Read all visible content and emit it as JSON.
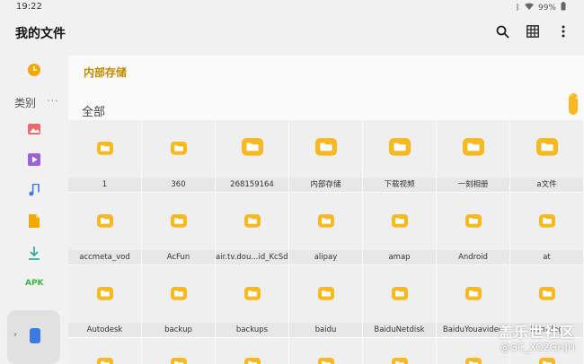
{
  "status": {
    "time": "19:22",
    "battery": "99%"
  },
  "app": {
    "title": "我的文件"
  },
  "sidebar": {
    "category_label": "类别",
    "more": "···",
    "apk_label": "APK"
  },
  "main": {
    "breadcrumb": "内部存储",
    "section": "全部",
    "scroll_hint": "⌃⌄"
  },
  "folders": [
    "1",
    "360",
    "268159164",
    "内部存储",
    "下载视频",
    "一刻相册",
    "a文件",
    "accmeta_vod",
    "AcFun",
    "air.tv.dou...id_KcSdk",
    "alipay",
    "amap",
    "Android",
    "at",
    "Autodesk",
    "backup",
    "backups",
    "baidu",
    "BaiduNetdisk",
    "BaiduYouavideo",
    "bamslog"
  ],
  "watermark": {
    "brand": "盖乐世社区",
    "handle": "@GC_XO2GHJH"
  },
  "colors": {
    "accent": "#f7b820",
    "breadcrumb": "#c38a00",
    "apk": "#3db346"
  }
}
